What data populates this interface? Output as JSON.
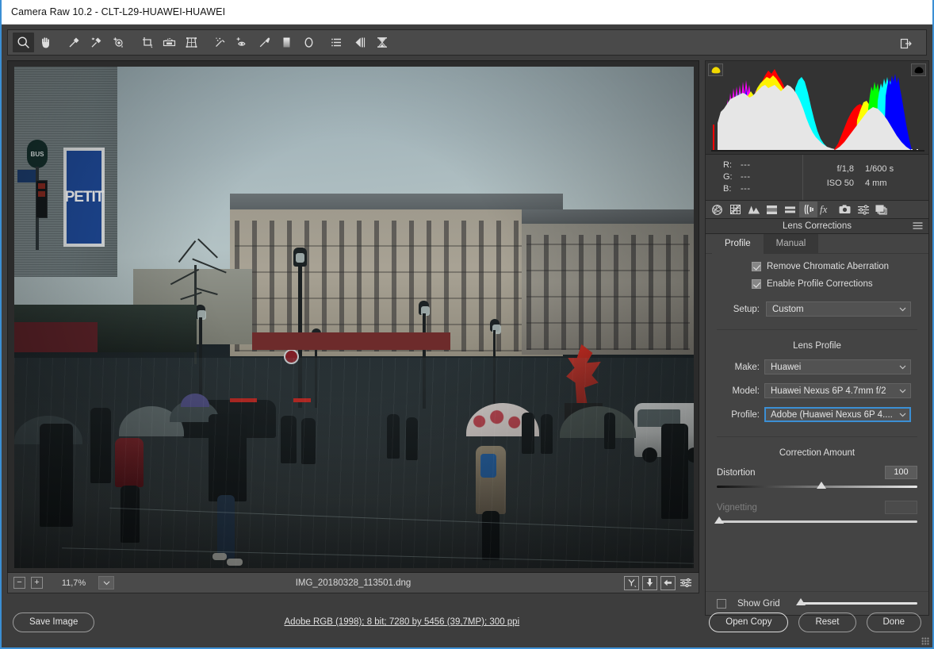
{
  "window": {
    "title": "Camera Raw 10.2  -  CLT-L29-HUAWEI-HUAWEI"
  },
  "toolbar": {
    "tools": [
      {
        "name": "zoom-tool",
        "glyph": "zoom",
        "selected": true
      },
      {
        "name": "hand-tool",
        "glyph": "hand",
        "selected": false
      },
      {
        "name": "white-balance-tool",
        "glyph": "eyedropper",
        "selected": false
      },
      {
        "name": "color-sampler-tool",
        "glyph": "color-sampler",
        "selected": false
      },
      {
        "name": "targeted-adjustment-tool",
        "glyph": "targeted-adjust",
        "selected": false
      },
      {
        "name": "crop-tool",
        "glyph": "crop",
        "selected": false
      },
      {
        "name": "straighten-tool",
        "glyph": "straighten",
        "selected": false
      },
      {
        "name": "transform-tool",
        "glyph": "transform",
        "selected": false
      },
      {
        "name": "spot-removal-tool",
        "glyph": "spot-removal",
        "selected": false
      },
      {
        "name": "red-eye-removal-tool",
        "glyph": "red-eye",
        "selected": false
      },
      {
        "name": "adjustment-brush-tool",
        "glyph": "brush",
        "selected": false
      },
      {
        "name": "graduated-filter-tool",
        "glyph": "graduated-filter",
        "selected": false
      },
      {
        "name": "radial-filter-tool",
        "glyph": "radial-filter",
        "selected": false
      },
      {
        "name": "preferences-tool",
        "glyph": "preferences",
        "selected": false
      },
      {
        "name": "rotate-left-tool",
        "glyph": "rotate-left",
        "selected": false
      },
      {
        "name": "rotate-right-tool",
        "glyph": "rotate-right",
        "selected": false
      }
    ],
    "open_preferences_right": "open-in-editor-icon"
  },
  "histogram": {
    "shadow_clipping_label": "shadow-clipping-indicator",
    "highlight_clipping_label": "highlight-clipping-indicator"
  },
  "info": {
    "rgb": [
      {
        "label": "R:",
        "value": "---"
      },
      {
        "label": "G:",
        "value": "---"
      },
      {
        "label": "B:",
        "value": "---"
      }
    ],
    "exif": {
      "aperture": "f/1,8",
      "shutter": "1/600 s",
      "iso": "ISO 50",
      "focal": "4 mm"
    }
  },
  "panel_tabs": [
    {
      "name": "basic-tab",
      "icon": "aperture-icon",
      "active": false
    },
    {
      "name": "tone-curve-tab",
      "icon": "curve-grid-icon",
      "active": false
    },
    {
      "name": "detail-tab",
      "icon": "mountains-icon",
      "active": false
    },
    {
      "name": "hsl-grayscale-tab",
      "icon": "hsl-bars-icon",
      "active": false
    },
    {
      "name": "split-toning-tab",
      "icon": "split-bars-icon",
      "active": false
    },
    {
      "name": "lens-corrections-tab",
      "icon": "lens-icon",
      "active": true
    },
    {
      "name": "effects-tab",
      "icon": "fx-icon",
      "active": false
    },
    {
      "name": "camera-calibration-tab",
      "icon": "camera-icon",
      "active": false
    },
    {
      "name": "presets-tab",
      "icon": "sliders-icon",
      "active": false
    },
    {
      "name": "snapshots-tab",
      "icon": "snapshots-icon",
      "active": false
    }
  ],
  "panel": {
    "title": "Lens Corrections",
    "menu_icon": "panel-menu-icon",
    "tabs": [
      {
        "label": "Profile",
        "active": true
      },
      {
        "label": "Manual",
        "active": false
      }
    ],
    "checkboxes": [
      {
        "label": "Remove Chromatic Aberration",
        "checked": true
      },
      {
        "label": "Enable Profile Corrections",
        "checked": true
      }
    ],
    "setup": {
      "label": "Setup:",
      "value": "Custom"
    },
    "lens_profile": {
      "title": "Lens Profile",
      "make": {
        "label": "Make:",
        "value": "Huawei"
      },
      "model": {
        "label": "Model:",
        "value": "Huawei Nexus 6P 4.7mm f/2"
      },
      "profile": {
        "label": "Profile:",
        "value": "Adobe (Huawei Nexus 6P 4....",
        "focused": true
      }
    },
    "correction_amount": {
      "title": "Correction Amount",
      "sliders": [
        {
          "name": "Distortion",
          "value": "100",
          "percent": 52,
          "enabled": true
        },
        {
          "name": "Vignetting",
          "value": "",
          "percent": 0,
          "enabled": false
        }
      ]
    },
    "show_grid": {
      "label": "Show Grid",
      "checked": false,
      "grid_size_percent": 3
    }
  },
  "image_bar": {
    "zoom_out": "−",
    "zoom_in": "+",
    "zoom_level": "11,7%",
    "zoom_caret": "chevron-down-icon",
    "filename": "IMG_20180328_113501.dng",
    "right_buttons": [
      {
        "name": "before-after-toggle-button",
        "glyph": "Y"
      },
      {
        "name": "swap-before-after-button",
        "glyph": "swap"
      },
      {
        "name": "copy-current-to-before-button",
        "glyph": "arrow-left"
      },
      {
        "name": "preview-preferences-button",
        "glyph": "sliders"
      }
    ]
  },
  "footer": {
    "save_image": "Save Image",
    "workflow_options": "Adobe RGB (1998); 8 bit; 7280 by 5456 (39,7MP); 300 ppi",
    "open_copy": "Open Copy",
    "reset": "Reset",
    "done": "Done"
  },
  "colors": {
    "accent": "#3b8fd4",
    "panel_bg": "#444444",
    "app_bg": "#3d3d3d",
    "toolbar_bg": "#4a4a4a",
    "text": "#dedede"
  },
  "photo": {
    "alt": "Rainy Paris street scene with pedestrians holding umbrellas, Haussmann buildings, a red sculpture, a white van and a PETIT billboard",
    "billboard_text": "PETIT",
    "bus_sign_text": "BUS"
  }
}
